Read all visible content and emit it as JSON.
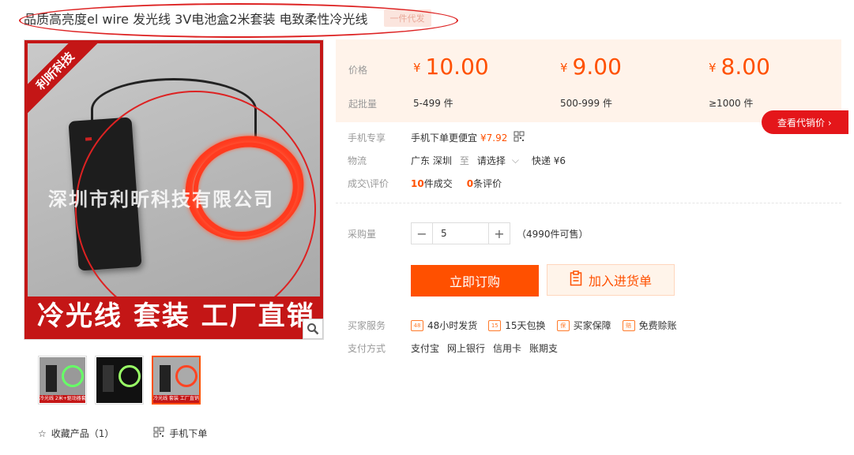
{
  "product": {
    "title": "品质高亮度el wire 发光线 3V电池盒2米套装 电致柔性冷光线",
    "tag": "一件代发"
  },
  "gallery": {
    "corner_text": "利昕科技",
    "watermark": "深圳市利昕科技有限公司",
    "banner_text": "冷光线 套装 工厂直销",
    "thumbnail_labels": [
      "冷光线 2米+驱动器套装",
      "",
      "冷光线 套装 工厂直销"
    ]
  },
  "pricing": {
    "price_label": "价格",
    "moq_label": "起批量",
    "currency": "¥",
    "tiers": [
      {
        "price": "10.00",
        "qty": "5-499 件"
      },
      {
        "price": "9.00",
        "qty": "500-999 件"
      },
      {
        "price": "8.00",
        "qty": "≥1000 件"
      }
    ],
    "agent_button": "查看代销价 ›"
  },
  "info": {
    "mobile_label": "手机专享",
    "mobile_text": "手机下单更便宜",
    "mobile_price": "¥7.92",
    "logistics_label": "物流",
    "origin": "广东 深圳",
    "to": "至",
    "destination": "请选择",
    "express": "快递 ¥6",
    "deals_label": "成交\\评价",
    "deals_count": "10",
    "deals_text": "件成交",
    "reviews_count": "0",
    "reviews_text": "条评价"
  },
  "purchase": {
    "qty_label": "采购量",
    "qty_value": "5",
    "stock_text": "（4990件可售）",
    "buy_button": "立即订购",
    "cart_button": "加入进货单"
  },
  "services": {
    "label": "买家服务",
    "items": [
      {
        "icon": "48",
        "text": "48小时发货"
      },
      {
        "icon": "15",
        "text": "15天包换"
      },
      {
        "icon": "保",
        "text": "买家保障"
      },
      {
        "icon": "赔",
        "text": "免费赊账"
      }
    ]
  },
  "payment": {
    "label": "支付方式",
    "methods": [
      "支付宝",
      "网上银行",
      "信用卡",
      "账期支"
    ]
  },
  "footer": {
    "favorite": "收藏产品（1）",
    "mobile_order": "手机下单"
  },
  "colors": {
    "accent": "#ff5000",
    "red": "#e4161a",
    "price_bg": "#fff3ea"
  }
}
